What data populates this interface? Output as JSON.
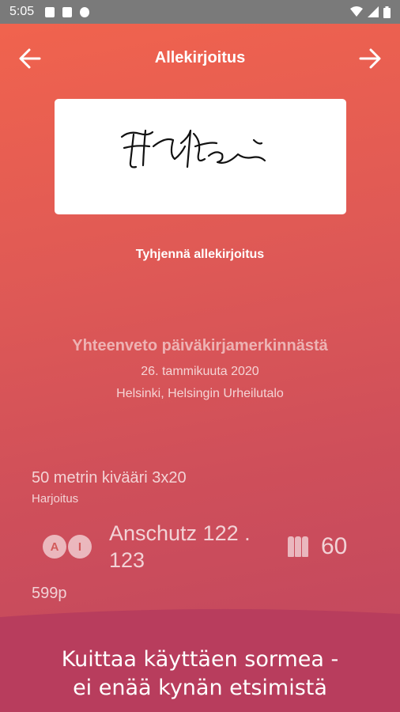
{
  "status_bar": {
    "time": "5:05",
    "icons": [
      "a-icon",
      "sd-card-icon",
      "sync-icon"
    ],
    "right_icons": [
      "wifi-icon",
      "signal-icon",
      "battery-icon"
    ]
  },
  "header": {
    "title": "Allekirjoitus",
    "back_icon": "arrow-left-icon",
    "forward_icon": "arrow-right-icon"
  },
  "signature": {
    "clear_label": "Tyhjennä allekirjoitus"
  },
  "summary": {
    "title": "Yhteenveto päiväkirjamerkinnästä",
    "date": "26. tammikuuta 2020",
    "location": "Helsinki, Helsingin Urheilutalo"
  },
  "entry": {
    "title": "50 metrin kivääri 3x20",
    "type": "Harjoitus",
    "badge_letters": [
      "A",
      "I"
    ],
    "weapon": "Anschutz 122 . 123",
    "shots": "60",
    "score": "599p"
  },
  "banner": {
    "line1": "Kuittaa käyttäen sormea -",
    "line2": "ei enää kynän etsimistä"
  },
  "colors": {
    "gradient_top": "#f2644d",
    "gradient_bottom": "#bf4660",
    "banner": "#b83d5d"
  }
}
